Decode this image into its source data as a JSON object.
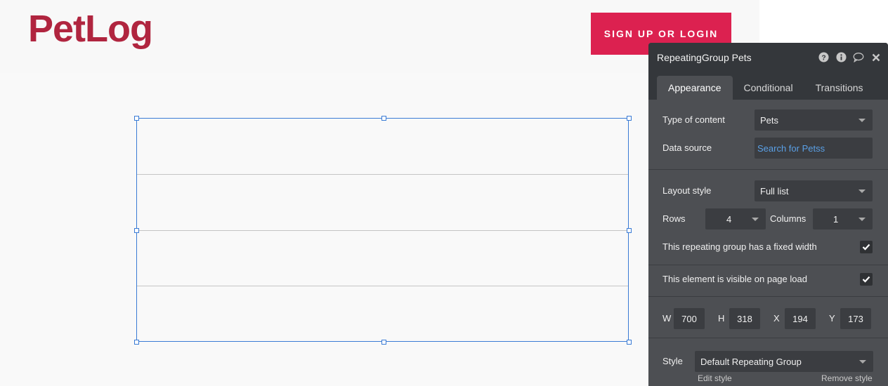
{
  "canvas": {
    "logo": "PetLog",
    "signup_button": "SIGN UP OR LOGIN"
  },
  "panel": {
    "title": "RepeatingGroup Pets",
    "header_icons": [
      "help-icon",
      "info-icon",
      "comment-icon",
      "close-icon"
    ],
    "tabs": [
      {
        "label": "Appearance",
        "active": true
      },
      {
        "label": "Conditional",
        "active": false
      },
      {
        "label": "Transitions",
        "active": false
      }
    ],
    "type_of_content": {
      "label": "Type of content",
      "value": "Pets"
    },
    "data_source": {
      "label": "Data source",
      "value": "Search for Petss"
    },
    "layout_style": {
      "label": "Layout style",
      "value": "Full list"
    },
    "rows": {
      "label": "Rows",
      "value": "4"
    },
    "columns": {
      "label": "Columns",
      "value": "1"
    },
    "fixed_width": {
      "label": "This repeating group has a fixed width",
      "checked": true
    },
    "visible_on_load": {
      "label": "This element is visible on page load",
      "checked": true
    },
    "geometry": {
      "w_label": "W",
      "w": "700",
      "h_label": "H",
      "h": "318",
      "x_label": "X",
      "x": "194",
      "y_label": "Y",
      "y": "173"
    },
    "style": {
      "label": "Style",
      "value": "Default Repeating Group",
      "edit_link": "Edit style",
      "remove_link": "Remove style"
    }
  },
  "colors": {
    "brand": "#b0253f",
    "button": "#dc2150",
    "selection": "#3a7bd5",
    "data_source_link": "#5aa0e6"
  }
}
